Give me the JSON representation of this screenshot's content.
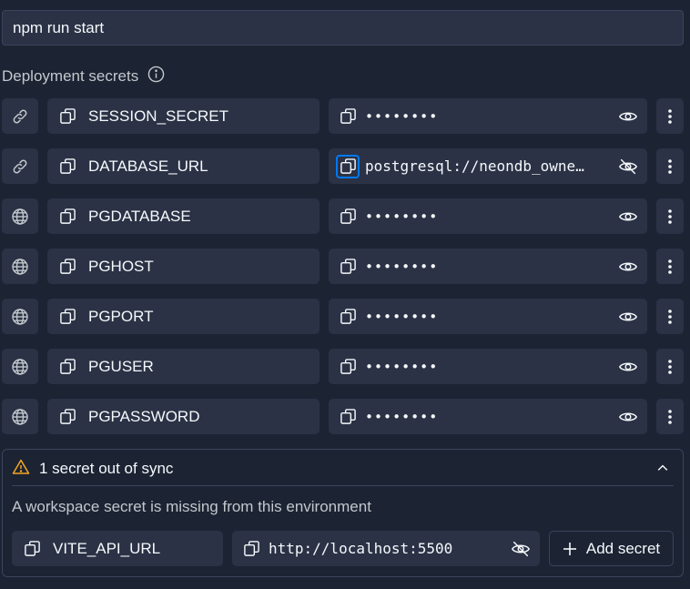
{
  "command": {
    "value": "npm run start"
  },
  "section": {
    "title": "Deployment secrets",
    "info_icon": "info-icon"
  },
  "rows": [
    {
      "kind": "link-icon",
      "key": "SESSION_SECRET",
      "value": "••••••••",
      "revealed": false
    },
    {
      "kind": "link-icon",
      "key": "DATABASE_URL",
      "value": "postgresql://neondb_owne…",
      "revealed": true
    },
    {
      "kind": "globe-icon",
      "key": "PGDATABASE",
      "value": "••••••••",
      "revealed": false
    },
    {
      "kind": "globe-icon",
      "key": "PGHOST",
      "value": "••••••••",
      "revealed": false
    },
    {
      "kind": "globe-icon",
      "key": "PGPORT",
      "value": "••••••••",
      "revealed": false
    },
    {
      "kind": "globe-icon",
      "key": "PGUSER",
      "value": "••••••••",
      "revealed": false
    },
    {
      "kind": "globe-icon",
      "key": "PGPASSWORD",
      "value": "••••••••",
      "revealed": false
    }
  ],
  "sync_panel": {
    "title": "1 secret out of sync",
    "description": "A workspace secret is missing from this environment",
    "key": "VITE_API_URL",
    "value": "http://localhost:5500",
    "add_label": "Add secret"
  },
  "colors": {
    "background": "#1c2333",
    "surface": "#2b3245",
    "border": "#3c445c",
    "focus": "#0079f2",
    "warning": "#f5a623",
    "text": "#f5f9fc",
    "muted": "#c2c8cc"
  }
}
